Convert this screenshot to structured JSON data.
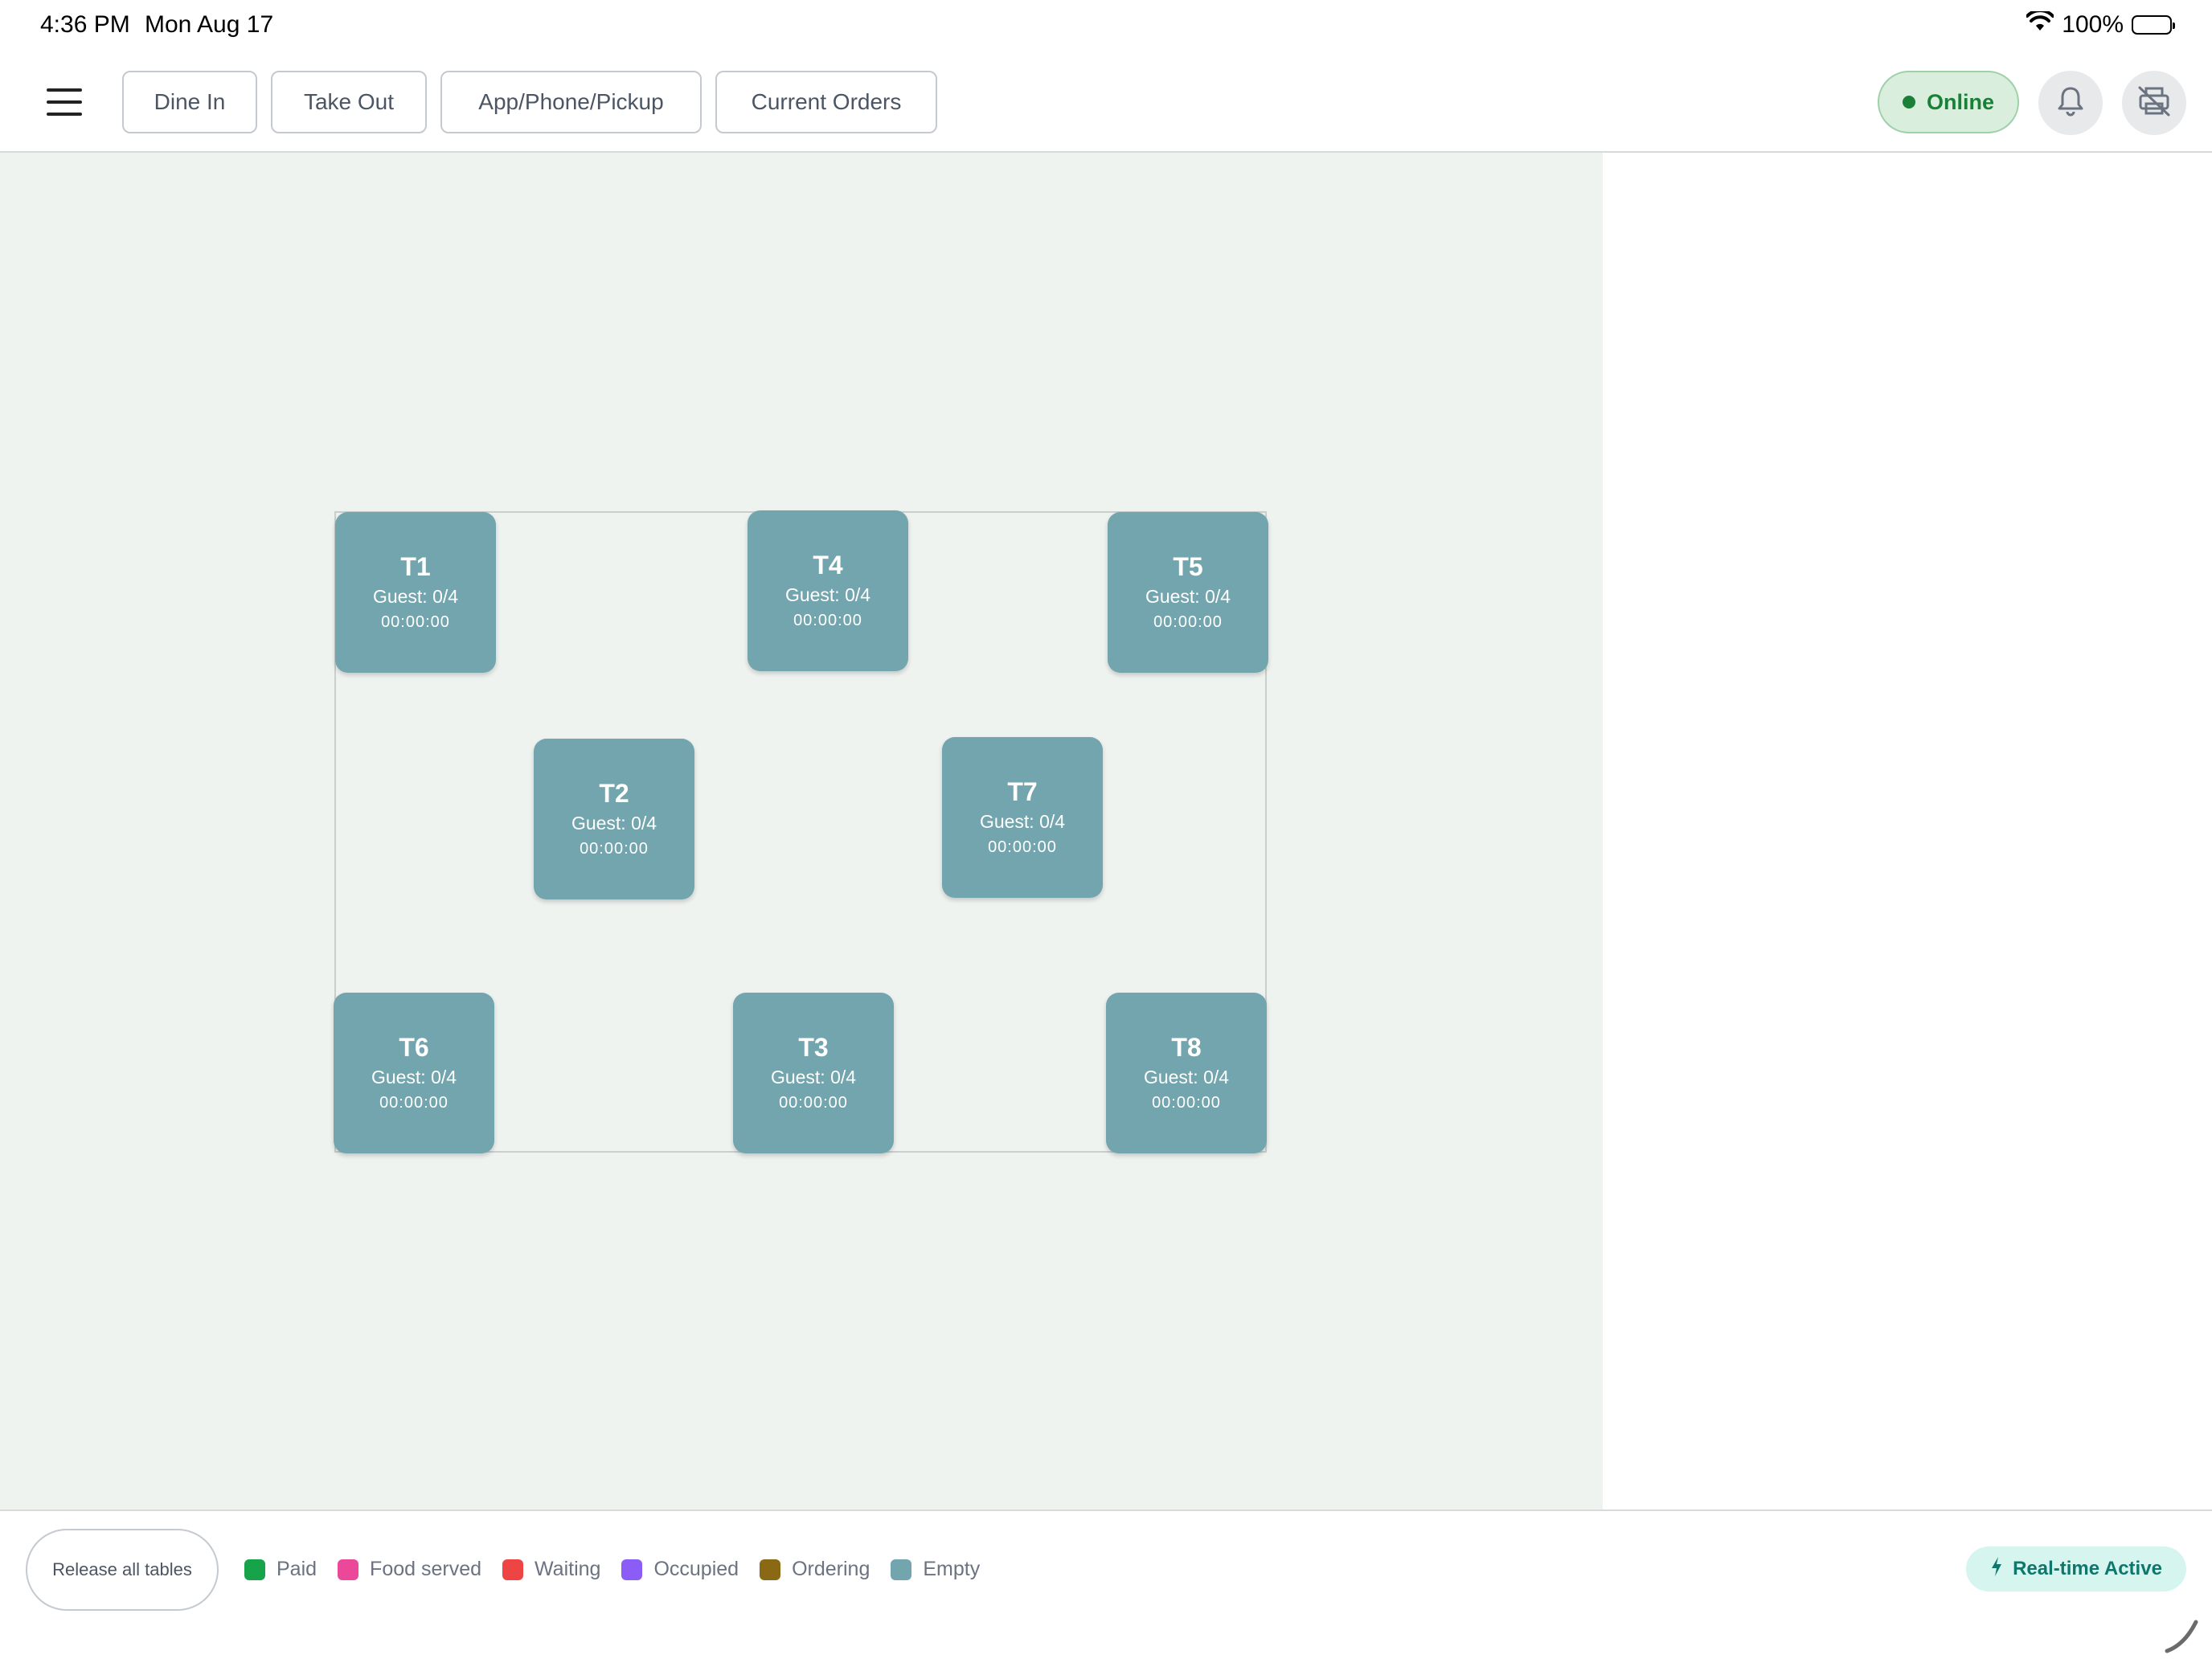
{
  "status_bar": {
    "time": "4:36 PM",
    "date": "Mon Aug 17",
    "battery": "100%"
  },
  "toolbar": {
    "tabs": [
      {
        "label": "Dine In"
      },
      {
        "label": "Take Out"
      },
      {
        "label": "App/Phone/Pickup"
      },
      {
        "label": "Current Orders"
      }
    ],
    "online_label": "Online",
    "icons": [
      "menu-icon",
      "bell-icon",
      "printer-off-icon"
    ]
  },
  "tables": [
    {
      "name": "T1",
      "guest": "Guest: 0/4",
      "time": "00:00:00"
    },
    {
      "name": "T4",
      "guest": "Guest: 0/4",
      "time": "00:00:00"
    },
    {
      "name": "T5",
      "guest": "Guest: 0/4",
      "time": "00:00:00"
    },
    {
      "name": "T2",
      "guest": "Guest: 0/4",
      "time": "00:00:00"
    },
    {
      "name": "T7",
      "guest": "Guest: 0/4",
      "time": "00:00:00"
    },
    {
      "name": "T6",
      "guest": "Guest: 0/4",
      "time": "00:00:00"
    },
    {
      "name": "T3",
      "guest": "Guest: 0/4",
      "time": "00:00:00"
    },
    {
      "name": "T8",
      "guest": "Guest: 0/4",
      "time": "00:00:00"
    }
  ],
  "bottom": {
    "release_label": "Release all tables",
    "legend": [
      {
        "label": "Paid",
        "color": "#16a34a"
      },
      {
        "label": "Food served",
        "color": "#ec4899"
      },
      {
        "label": "Waiting",
        "color": "#ef4444"
      },
      {
        "label": "Occupied",
        "color": "#8b5cf6"
      },
      {
        "label": "Ordering",
        "color": "#8b6914"
      },
      {
        "label": "Empty",
        "color": "#72a5ad"
      }
    ],
    "realtime_label": "Real-time Active"
  },
  "colors": {
    "table_empty": "#72a5ad",
    "floor_bg": "#eff3f0",
    "online_green": "#1a7f37",
    "realtime_teal": "#0f766e"
  }
}
